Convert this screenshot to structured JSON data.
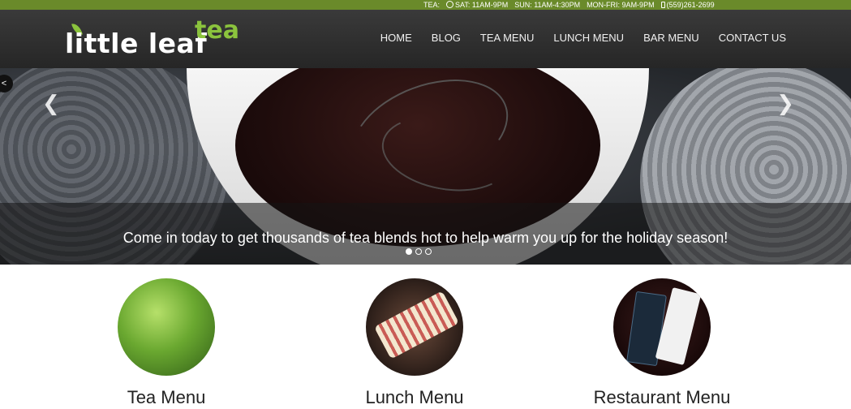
{
  "topbar": {
    "tea_label": "TEA:",
    "sat": "SAT: 11AM-9PM",
    "sun": "SUN: 11AM-4:30PM",
    "monfri": "MON-FRI: 9AM-9PM",
    "phone": "(559)261-2699"
  },
  "logo": {
    "main": "little leaf",
    "accent": "tea"
  },
  "nav": [
    {
      "label": "HOME"
    },
    {
      "label": "BLOG"
    },
    {
      "label": "TEA MENU"
    },
    {
      "label": "LUNCH MENU"
    },
    {
      "label": "BAR MENU"
    },
    {
      "label": "CONTACT US"
    }
  ],
  "hero": {
    "caption": "Come in today to get thousands of tea blends hot to help warm you up for the holiday season!",
    "slides": 3,
    "active_slide": 1
  },
  "features": [
    {
      "title": "Tea Menu"
    },
    {
      "title": "Lunch Menu"
    },
    {
      "title": "Restaurant Menu"
    }
  ],
  "colors": {
    "topbar": "#6a8a2a",
    "accent": "#8bc33d",
    "header": "#2e2e2e"
  }
}
